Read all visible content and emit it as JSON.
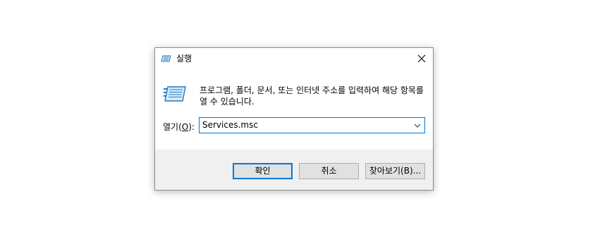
{
  "window": {
    "title": "실행"
  },
  "description": "프로그램, 폴더, 문서, 또는 인터넷 주소를 입력하여 해당 항목를 열 수 있습니다.",
  "open": {
    "label_prefix": "열기(",
    "label_mnemonic": "O",
    "label_suffix": "):",
    "value": "Services.msc"
  },
  "buttons": {
    "ok": "확인",
    "cancel": "취소",
    "browse": "찾아보기(B)..."
  },
  "colors": {
    "accent": "#0078d7",
    "footer_bg": "#f0f0f0",
    "button_bg": "#e1e1e1"
  },
  "icons": {
    "title": "run-icon",
    "close": "close-icon",
    "main": "run-icon",
    "dropdown": "chevron-down-icon"
  }
}
